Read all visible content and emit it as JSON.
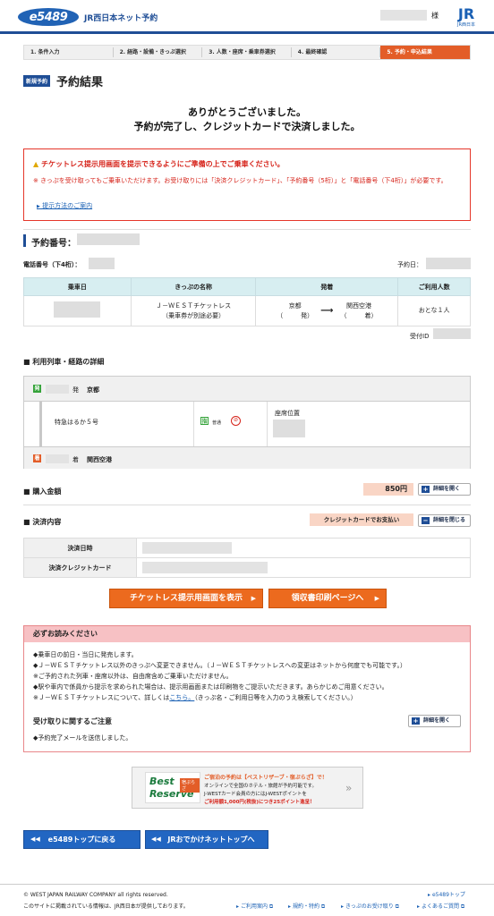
{
  "header": {
    "logo": "e5489",
    "title": "JR西日本ネット予約",
    "user_suffix": "様",
    "jr_logo": "JR",
    "jr_logo_sub": "JR西日本"
  },
  "steps": [
    "1. 条件入力",
    "2. 経路・設備・きっぷ選択",
    "3. 人数・座席・乗車券選択",
    "4. 最終確認",
    "5. 予約・申込結果"
  ],
  "title": {
    "badge": "新規予約",
    "text": "予約結果"
  },
  "thanks": {
    "line1": "ありがとうございました。",
    "line2": "予約が完了し、クレジットカードで決済しました。"
  },
  "notice": {
    "title": "チケットレス提示用画面を提示できるようにご準備の上でご乗車ください。",
    "body": "※ きっぷを受け取ってもご乗車いただけます。お受け取りには「決済クレジットカード」、「予約番号（5桁）」と「電話番号（下4桁）」が必要です。",
    "link": "提示方法のご案内"
  },
  "reservation": {
    "title": "予約番号：",
    "phone_label": "電話番号（下4桁）：",
    "date_label": "予約日：",
    "columns": [
      "乗車日",
      "きっぷの名称",
      "発着",
      "ご利用人数"
    ],
    "ticket_name": "Ｊ－ＷＥＳＴチケットレス",
    "ticket_note": "（乗車券が別途必要）",
    "from": "京都",
    "to": "関西空港",
    "dep_suffix": "発）",
    "arr_suffix": "着）",
    "arrow": "⟶",
    "people": "おとな１人",
    "receipt_id_label": "受付ID"
  },
  "route": {
    "title": "利用列車・経路の詳細",
    "dep_badge": "発",
    "dep_suffix": "発",
    "dep_station": "京都",
    "train_name": "特急はるか５号",
    "seat_badge": "指",
    "seat_type": "普通",
    "seat_label": "座席位置",
    "arr_badge": "着",
    "arr_suffix": "着",
    "arr_station": "関西空港"
  },
  "purchase": {
    "title": "購入金額",
    "amount": "850円",
    "detail_btn": "詳細を開く"
  },
  "payment": {
    "title": "決済内容",
    "badge": "クレジットカードでお支払い",
    "close_btn": "詳細を閉じる",
    "rows": [
      "決済日時",
      "決済クレジットカード"
    ]
  },
  "buttons": {
    "ticketless": "チケットレス提示用画面を表示",
    "receipt": "領収書印刷ページへ"
  },
  "must_read": {
    "title": "必ずお読みください",
    "l1": "◆乗車日の前日・当日に発売します。",
    "l2": "◆Ｊ－ＷＥＳＴチケットレス以外のきっぷへ変更できません。（Ｊ－ＷＥＳＴチケットレスへの変更はネットから何度でも可能です。）",
    "l3": "※ご予約された列車・座席以外は、自由席含めご乗車いただけません。",
    "l4": "◆駅や車内で係員から提示を求められた場合は、提示用画面または印刷物をご提示いただきます。あらかじめご用意ください。",
    "l5a": "※Ｊ－ＷＥＳＴチケットレスについて、詳しくは",
    "l5link": "こちら。",
    "l5b": "（きっぷ名・ご利用日等を入力のうえ検索してください。）",
    "sub_title": "受け取りに関するご注意",
    "sub_btn": "詳細を開く",
    "sub_body": "◆予約完了メールを送信しました。"
  },
  "banner": {
    "logo1": "Best",
    "logo2": "Reserve",
    "logo_tag": "宿ぷらざ",
    "l1": "ご宿泊の予約は【ベストリザーブ・宿ぷらざ】で！",
    "l2": "オンラインで全国のホテル・旅館が予約可能です。",
    "l3": "J-WESTカード会員の方にはJ-WESTポイントを",
    "l4": "ご利用額1,000円(税抜)につき25ポイント進呈！"
  },
  "nav": {
    "top": "e5489トップに戻る",
    "odekake": "JRおでかけネットトップへ"
  },
  "footer": {
    "copyright": "© WEST JAPAN RAILWAY COMPANY all rights reserved.",
    "disclaimer": "このサイトに掲載されている情報は、JR西日本が提供しております。",
    "e5489_top": "e5489トップ",
    "links": [
      "ご利用案内",
      "規約・特約",
      "きっぷのお受け取り",
      "よくあるご質問"
    ]
  },
  "colors": {
    "brand": "#1f4e96",
    "accent": "#e35d28",
    "alert": "#d6231a"
  }
}
